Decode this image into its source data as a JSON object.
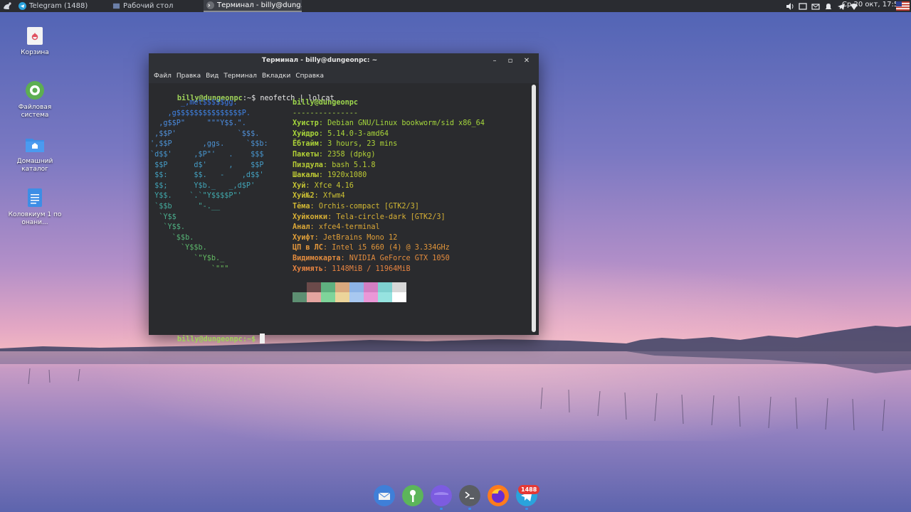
{
  "panel": {
    "tasks": [
      {
        "label": "Telegram (1488)",
        "active": false
      },
      {
        "label": "Рабочий стол",
        "active": false
      },
      {
        "label": "Терминал - billy@dung...",
        "active": true
      }
    ],
    "clock": "Ср 20 окт, 17:57",
    "tray_icons": [
      "volume-icon",
      "tray-window-icon",
      "mail-icon",
      "bell-icon",
      "telegram-tray-icon",
      "network-icon"
    ]
  },
  "desktop": {
    "icons": [
      {
        "label": "Корзина",
        "icon": "trash-icon"
      },
      {
        "label": "Файловая система",
        "icon": "filesystem-icon"
      },
      {
        "label": "Домашний каталог",
        "icon": "home-folder-icon"
      },
      {
        "label": "Коловкиум 1 по онани...",
        "icon": "document-icon"
      }
    ]
  },
  "terminal": {
    "title": "Терминал - billy@dungeonpc: ~",
    "menu": [
      "Файл",
      "Правка",
      "Вид",
      "Терминал",
      "Вкладки",
      "Справка"
    ],
    "prompt_user": "billy@dungeonpc",
    "prompt_path": ":~$",
    "command": "neofetch | lolcat",
    "logo_lines": [
      "       _,met$$$$$gg.",
      "    ,g$$$$$$$$$$$$$$$P.",
      "  ,g$$P\"     \"\"\"Y$$.\".",
      " ,$$P'              `$$$.",
      "',$$P       ,ggs.     `$$b:",
      "`d$$'     ,$P\"'   .    $$$",
      " $$P      d$'     ,    $$P",
      " $$:      $$.   -    ,d$$'",
      " $$;      Y$b._   _,d$P'",
      " Y$$.    `.`\"Y$$$$P\"'",
      " `$$b      \"-.__",
      "  `Y$$",
      "   `Y$$.",
      "     `$$b.",
      "       `Y$$b.",
      "          `\"Y$b._",
      "              `\"\"\""
    ],
    "info_header": "billy@dungeonpc",
    "info_separator": "---------------",
    "info": [
      {
        "key": "Хуистр",
        "value": "Debian GNU/Linux bookworm/sid x86_64"
      },
      {
        "key": "Хуйдро",
        "value": "5.14.0-3-amd64"
      },
      {
        "key": "Ёбтайм",
        "value": "3 hours, 23 mins"
      },
      {
        "key": "Пакеты",
        "value": "2358 (dpkg)"
      },
      {
        "key": "Пиздула",
        "value": "bash 5.1.8"
      },
      {
        "key": "Шакалы",
        "value": "1920x1080"
      },
      {
        "key": "Хуй",
        "value": "Xfce 4.16"
      },
      {
        "key": "Хуй№2",
        "value": "Xfwm4"
      },
      {
        "key": "Тёма",
        "value": "Orchis-compact [GTK2/3]"
      },
      {
        "key": "Хуйконки",
        "value": "Tela-circle-dark [GTK2/3]"
      },
      {
        "key": "Анал",
        "value": "xfce4-terminal"
      },
      {
        "key": "Хуифт",
        "value": "JetBrains Mono 12"
      },
      {
        "key": "ЦП в ЛС",
        "value": "Intel i5 660 (4) @ 3.334GHz"
      },
      {
        "key": "Видимокарта",
        "value": "NVIDIA GeForce GTX 1050"
      },
      {
        "key": "Хуямять",
        "value": "1148MiB / 11964MiB"
      }
    ],
    "palette_top": [
      "#2a2b2e",
      "#6b4a4a",
      "#5fb07f",
      "#d9a87e",
      "#8cb3e6",
      "#d27ec2",
      "#7ed0cf",
      "#d7d7d7"
    ],
    "palette_bottom": [
      "#5d8f72",
      "#e4a5a0",
      "#7fd49a",
      "#ecd49a",
      "#a8c8f0",
      "#ea97d7",
      "#96e3e0",
      "#ffffff"
    ],
    "final_prompt": "billy@dungeonpc:~$"
  },
  "dock": {
    "items": [
      "mail-client-icon",
      "keepassxc-icon",
      "purple-app-icon",
      "terminal-icon",
      "firefox-icon",
      "telegram-icon"
    ],
    "telegram_badge": "1488"
  }
}
